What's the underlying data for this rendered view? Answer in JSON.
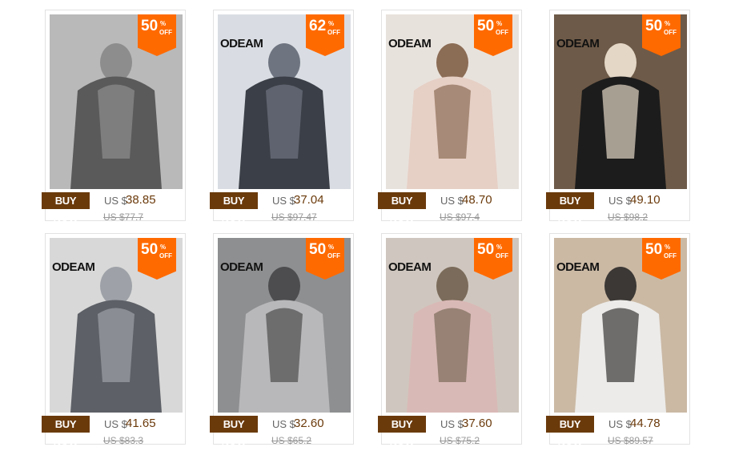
{
  "products": [
    {
      "discount": "50",
      "percent_sign": "%",
      "off": "OFF",
      "brand": "",
      "buy_label": "BUY NOW",
      "currency": "US $",
      "price": "38.85",
      "old_price": "US $77.7",
      "palette": [
        "#b9b9b9",
        "#5a5a5a",
        "#8d8d8d"
      ]
    },
    {
      "discount": "62",
      "percent_sign": "%",
      "off": "OFF",
      "brand": "ODEAM",
      "buy_label": "BUY NOW",
      "currency": "US $",
      "price": "37.04",
      "old_price": "US $97.47",
      "palette": [
        "#d9dde3",
        "#3b3f47",
        "#6e7480"
      ]
    },
    {
      "discount": "50",
      "percent_sign": "%",
      "off": "OFF",
      "brand": "ODEAM",
      "buy_label": "BUY NOW",
      "currency": "US $",
      "price": "48.70",
      "old_price": "US $97.4",
      "palette": [
        "#e8e2dc",
        "#e6cfc5",
        "#8b6c55"
      ]
    },
    {
      "discount": "50",
      "percent_sign": "%",
      "off": "OFF",
      "brand": "ODEAM",
      "buy_label": "BUY NOW",
      "currency": "US $",
      "price": "49.10",
      "old_price": "US $98.2",
      "palette": [
        "#6e5a48",
        "#1c1c1c",
        "#e4d7c6"
      ]
    },
    {
      "discount": "50",
      "percent_sign": "%",
      "off": "OFF",
      "brand": "ODEAM",
      "buy_label": "BUY NOW",
      "currency": "US $",
      "price": "41.65",
      "old_price": "US $83.3",
      "palette": [
        "#d8d8d8",
        "#5d6066",
        "#9ea2a8"
      ]
    },
    {
      "discount": "50",
      "percent_sign": "%",
      "off": "OFF",
      "brand": "ODEAM",
      "buy_label": "BUY NOW",
      "currency": "US $",
      "price": "32.60",
      "old_price": "US $65.2",
      "palette": [
        "#8e8f90",
        "#b8b8ba",
        "#4d4d4f"
      ]
    },
    {
      "discount": "50",
      "percent_sign": "%",
      "off": "OFF",
      "brand": "ODEAM",
      "buy_label": "BUY NOW",
      "currency": "US $",
      "price": "37.60",
      "old_price": "US $75.2",
      "palette": [
        "#cfc7bf",
        "#d9b9b6",
        "#7b6b5a"
      ]
    },
    {
      "discount": "50",
      "percent_sign": "%",
      "off": "OFF",
      "brand": "ODEAM",
      "buy_label": "BUY NOW",
      "currency": "US $",
      "price": "44.78",
      "old_price": "US $89.57",
      "palette": [
        "#cbb9a4",
        "#ecebe9",
        "#3b3835"
      ]
    }
  ]
}
